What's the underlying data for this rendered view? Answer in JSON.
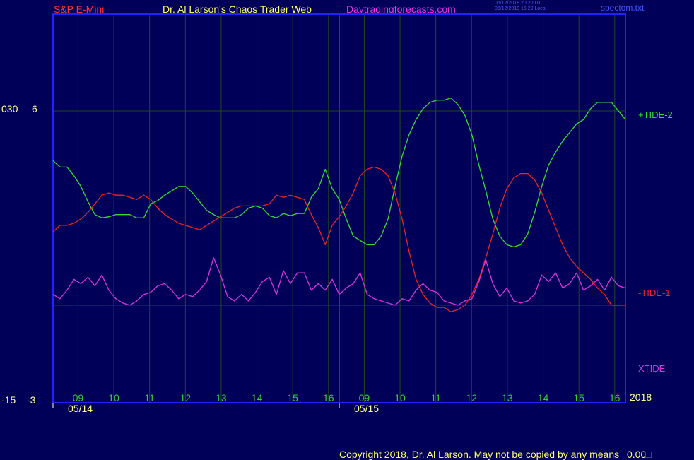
{
  "header": {
    "symbol": "S&P E-Mini",
    "title": "Dr. Al Larson's Chaos Trader Web",
    "site": "Daytradingforecasts.com",
    "stamp_ut": "05/12/2018 20:20 UT",
    "stamp_local": "05/12/2018 15:20 Local",
    "file": "spectom.txt"
  },
  "colors": {
    "background": "#000059",
    "frame": "#2222ff",
    "grid": "#1f4a1f",
    "symbol": "#ff3333",
    "title": "#ffff66",
    "site": "#ee33ee",
    "stamp": "#5555ff",
    "plus_tide": "#33dd33",
    "minus_tide": "#ee2222",
    "xtide": "#dd33dd",
    "hour_ticks": "#33cc33",
    "axis_text": "#ffff88"
  },
  "left_axis": {
    "upper": [
      "030",
      "6"
    ],
    "lower": [
      "-15",
      "-3"
    ]
  },
  "footer": {
    "copyright": "Copyright 2018, Dr. Al Larson. May not be copied by any means",
    "value": "0.00"
  },
  "chart_data": {
    "type": "line",
    "title": "",
    "x_hour_labels": [
      "09",
      "10",
      "11",
      "12",
      "13",
      "14",
      "15",
      "16",
      "09",
      "10",
      "11",
      "12",
      "13",
      "14",
      "15",
      "16"
    ],
    "x_date_labels": [
      "05/14",
      "05/15"
    ],
    "year_label": "2018",
    "y_labels": {
      "top": "6",
      "bottom": "-3"
    },
    "ylim": [
      -3,
      6
    ],
    "grid": true,
    "legend": "right",
    "series": [
      {
        "name": "+TIDE-2",
        "color": "#33dd33",
        "values": [
          3.7,
          3.4,
          3.4,
          3.0,
          2.5,
          1.8,
          1.2,
          1.05,
          1.1,
          1.2,
          1.2,
          1.2,
          1.05,
          1.05,
          1.7,
          1.85,
          2.1,
          2.3,
          2.5,
          2.5,
          2.2,
          1.8,
          1.4,
          1.2,
          1.05,
          1.05,
          1.05,
          1.2,
          1.5,
          1.6,
          1.5,
          1.15,
          1.05,
          1.25,
          1.15,
          1.25,
          1.25,
          2.0,
          2.4,
          3.3,
          2.4,
          1.9,
          1.0,
          0.2,
          0.0,
          -0.2,
          -0.2,
          0.2,
          1.0,
          2.5,
          3.9,
          4.9,
          5.6,
          6.1,
          6.4,
          6.5,
          6.5,
          6.6,
          6.3,
          5.8,
          4.9,
          3.5,
          2.3,
          1.0,
          0.2,
          -0.2,
          -0.3,
          -0.2,
          0.3,
          1.3,
          2.5,
          3.5,
          4.1,
          4.6,
          5.0,
          5.4,
          5.6,
          6.1,
          6.4,
          6.4,
          6.4,
          6.0,
          5.6
        ]
      },
      {
        "name": "-TIDE-1",
        "color": "#ee2222",
        "values": [
          0.4,
          0.7,
          0.7,
          0.8,
          1.0,
          1.3,
          1.7,
          2.1,
          2.2,
          2.1,
          2.1,
          2.0,
          1.9,
          2.1,
          1.9,
          1.5,
          1.2,
          1.0,
          0.8,
          0.7,
          0.6,
          0.5,
          0.7,
          0.9,
          1.1,
          1.3,
          1.5,
          1.6,
          1.6,
          1.6,
          1.6,
          1.7,
          2.1,
          2.0,
          2.1,
          2.0,
          1.9,
          1.2,
          0.6,
          -0.2,
          0.7,
          1.1,
          1.6,
          2.2,
          3.0,
          3.3,
          3.4,
          3.3,
          3.0,
          2.2,
          1.0,
          -0.5,
          -1.8,
          -2.5,
          -2.9,
          -3.1,
          -3.1,
          -3.3,
          -3.2,
          -3.0,
          -2.5,
          -1.8,
          -0.8,
          0.3,
          1.5,
          2.4,
          2.9,
          3.1,
          3.1,
          2.8,
          2.2,
          1.4,
          0.6,
          -0.2,
          -0.8,
          -1.2,
          -1.5,
          -1.8,
          -2.2,
          -2.5,
          -3.0,
          -3.0,
          -3.0
        ]
      },
      {
        "name": "XTIDE",
        "color": "#dd33dd",
        "values": [
          -2.5,
          -2.7,
          -2.3,
          -1.8,
          -2.0,
          -1.7,
          -2.1,
          -1.6,
          -2.3,
          -2.7,
          -2.9,
          -3.0,
          -2.8,
          -2.5,
          -2.4,
          -2.1,
          -2.0,
          -2.3,
          -2.7,
          -2.5,
          -2.6,
          -2.3,
          -1.9,
          -0.8,
          -1.6,
          -2.6,
          -2.8,
          -2.5,
          -2.8,
          -2.4,
          -1.9,
          -1.7,
          -2.5,
          -1.4,
          -2.0,
          -1.5,
          -1.5,
          -2.3,
          -2.0,
          -2.3,
          -1.8,
          -2.5,
          -2.2,
          -2.0,
          -1.5,
          -2.5,
          -2.7,
          -2.8,
          -2.9,
          -3.0,
          -2.7,
          -2.8,
          -2.3,
          -2.0,
          -2.3,
          -2.4,
          -2.8,
          -2.9,
          -3.0,
          -2.8,
          -2.7,
          -1.9,
          -0.9,
          -2.0,
          -2.6,
          -2.2,
          -2.8,
          -2.9,
          -2.8,
          -2.5,
          -1.6,
          -1.9,
          -1.5,
          -2.2,
          -2.0,
          -1.5,
          -2.3,
          -2.1,
          -1.8,
          -2.3,
          -1.7,
          -2.1,
          -2.2
        ]
      }
    ]
  }
}
